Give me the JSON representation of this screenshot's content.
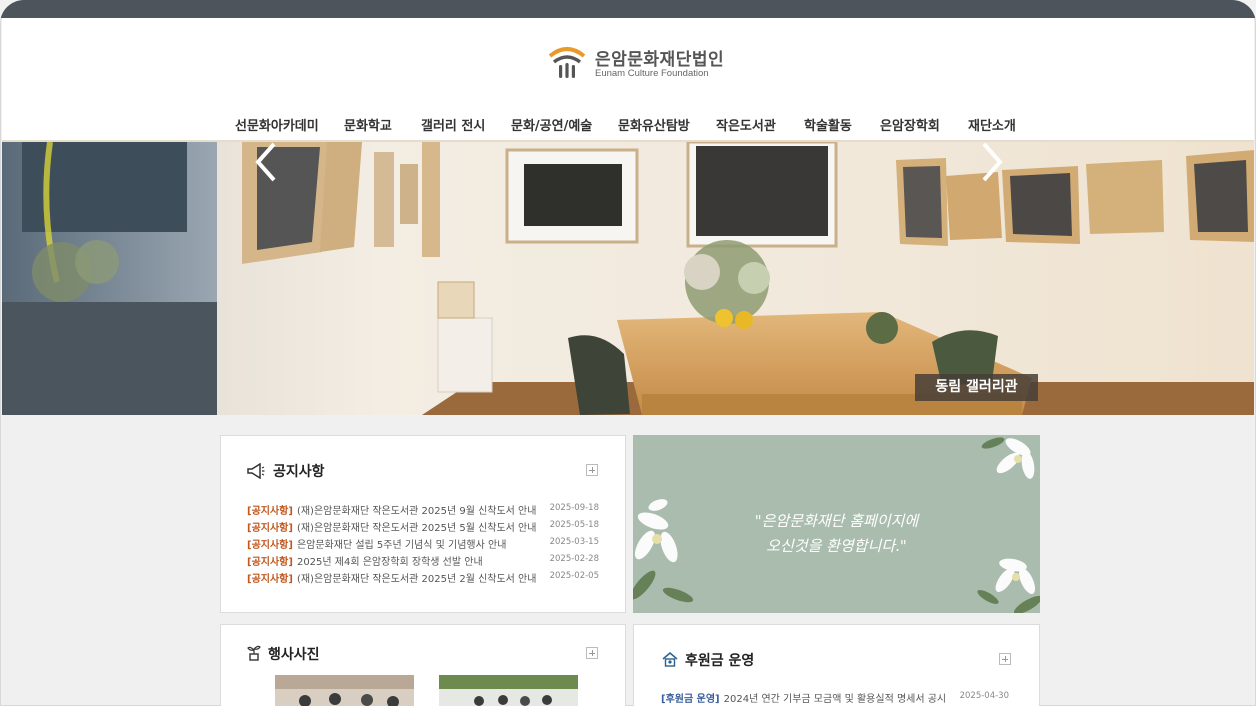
{
  "header": {
    "logo_title": "은암문화재단법인",
    "logo_subtitle": "Eunam Culture Foundation"
  },
  "nav": {
    "items": [
      {
        "label": "선문화아카데미"
      },
      {
        "label": "문화학교"
      },
      {
        "label": "갤러리 전시"
      },
      {
        "label": "문화/공연/예술"
      },
      {
        "label": "문화유산탐방"
      },
      {
        "label": "작은도서관"
      },
      {
        "label": "학술활동"
      },
      {
        "label": "은암장학회"
      },
      {
        "label": "재단소개"
      }
    ]
  },
  "hero": {
    "caption": "동림 갤러리관",
    "prev_icon": "chevron-left-icon",
    "next_icon": "chevron-right-icon"
  },
  "notices": {
    "title": "공지사항",
    "icon": "megaphone-icon",
    "items": [
      {
        "tag": "[공지사항]",
        "text": "(재)은암문화재단 작은도서관 2025년 9월 신착도서 안내",
        "date": "2025-09-18"
      },
      {
        "tag": "[공지사항]",
        "text": "(재)은암문화재단 작은도서관 2025년 5월 신착도서 안내",
        "date": "2025-05-18"
      },
      {
        "tag": "[공지사항]",
        "text": "은암문화재단 설립 5주년 기념식 및 기념행사 안내",
        "date": "2025-03-15"
      },
      {
        "tag": "[공지사항]",
        "text": "2025년 제4회 은암장학회 장학생 선발 안내",
        "date": "2025-02-28"
      },
      {
        "tag": "[공지사항]",
        "text": "(재)은암문화재단 작은도서관 2025년 2월 신착도서 안내",
        "date": "2025-02-05"
      }
    ]
  },
  "welcome": {
    "line1": "\"은암문화재단 홈페이지에",
    "line2": "오신것을 환영합니다.\""
  },
  "events": {
    "title": "행사사진",
    "icon": "plant-icon"
  },
  "donation": {
    "title": "후원금 운영",
    "icon": "house-icon",
    "items": [
      {
        "tag": "[후원금 운영]",
        "text": "2024년 연간 기부금 모금액 및 활용실적 명세서 공시",
        "date": "2025-04-30"
      }
    ]
  },
  "colors": {
    "topbar": "#4d545c",
    "accent_orange": "#c0581f",
    "donation_tag": "#3a5f9c",
    "welcome_bg": "#a9bcae"
  }
}
